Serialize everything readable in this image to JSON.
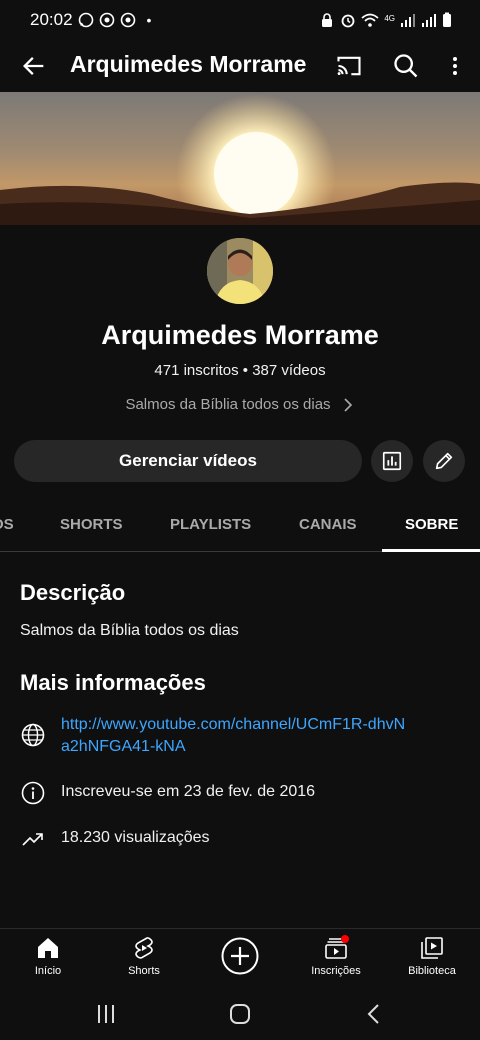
{
  "status": {
    "time": "20:02",
    "dot": "•",
    "network": "4G"
  },
  "app_bar": {
    "title": "Arquimedes Morrame"
  },
  "channel": {
    "name": "Arquimedes Morrame",
    "stats": "471 inscritos • 387 vídeos",
    "tagline": "Salmos da Bíblia todos os dias",
    "manage_label": "Gerenciar vídeos"
  },
  "tabs": [
    {
      "label": "OS"
    },
    {
      "label": "SHORTS"
    },
    {
      "label": "PLAYLISTS"
    },
    {
      "label": "CANAIS"
    },
    {
      "label": "SOBRE",
      "active": true
    }
  ],
  "about": {
    "description_title": "Descrição",
    "description_text": "Salmos da Bíblia todos os dias",
    "more_info_title": "Mais informações",
    "link": "http://www.youtube.com/channel/UCmF1R-dhvNa2hNFGA41-kNA",
    "joined": "Inscreveu-se em 23 de fev. de 2016",
    "views": "18.230 visualizações"
  },
  "bottom_nav": [
    {
      "label": "Início",
      "icon": "home-icon"
    },
    {
      "label": "Shorts",
      "icon": "shorts-icon"
    },
    {
      "label": "",
      "icon": "create-icon"
    },
    {
      "label": "Inscrições",
      "icon": "subscriptions-icon"
    },
    {
      "label": "Biblioteca",
      "icon": "library-icon"
    }
  ],
  "colors": {
    "background": "#0f0f0f",
    "button": "#272727",
    "link": "#3ea6ff",
    "notification": "#ff0000"
  }
}
